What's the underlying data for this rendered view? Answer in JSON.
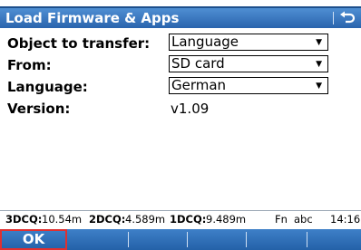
{
  "title_bar": {
    "title": "Load Firmware & Apps",
    "back_icon": "return-arrow-icon"
  },
  "form": {
    "object_to_transfer": {
      "label": "Object to transfer:",
      "value": "Language"
    },
    "from": {
      "label": "From:",
      "value": "SD card"
    },
    "language": {
      "label": "Language:",
      "value": "German"
    },
    "version": {
      "label": "Version:",
      "value": "v1.09"
    },
    "dropdown_icon": "triangle-down-icon"
  },
  "status_bar": {
    "quality_3d_label": "3DCQ:",
    "quality_3d_value": "10.54m",
    "quality_2d_label": "2DCQ:",
    "quality_2d_value": "4.589m",
    "quality_1d_label": "1DCQ:",
    "quality_1d_value": "9.489m",
    "fn_indicator": "Fn",
    "input_mode": "abc",
    "time": "14:16"
  },
  "softkeys": {
    "f1": "OK",
    "f2": "",
    "f3": "",
    "f4": "",
    "f5": "",
    "f6": ""
  },
  "colors": {
    "title_bar": "#2a64ad",
    "softkey_bar": "#2461a8",
    "active_softkey_border": "#e03030"
  }
}
